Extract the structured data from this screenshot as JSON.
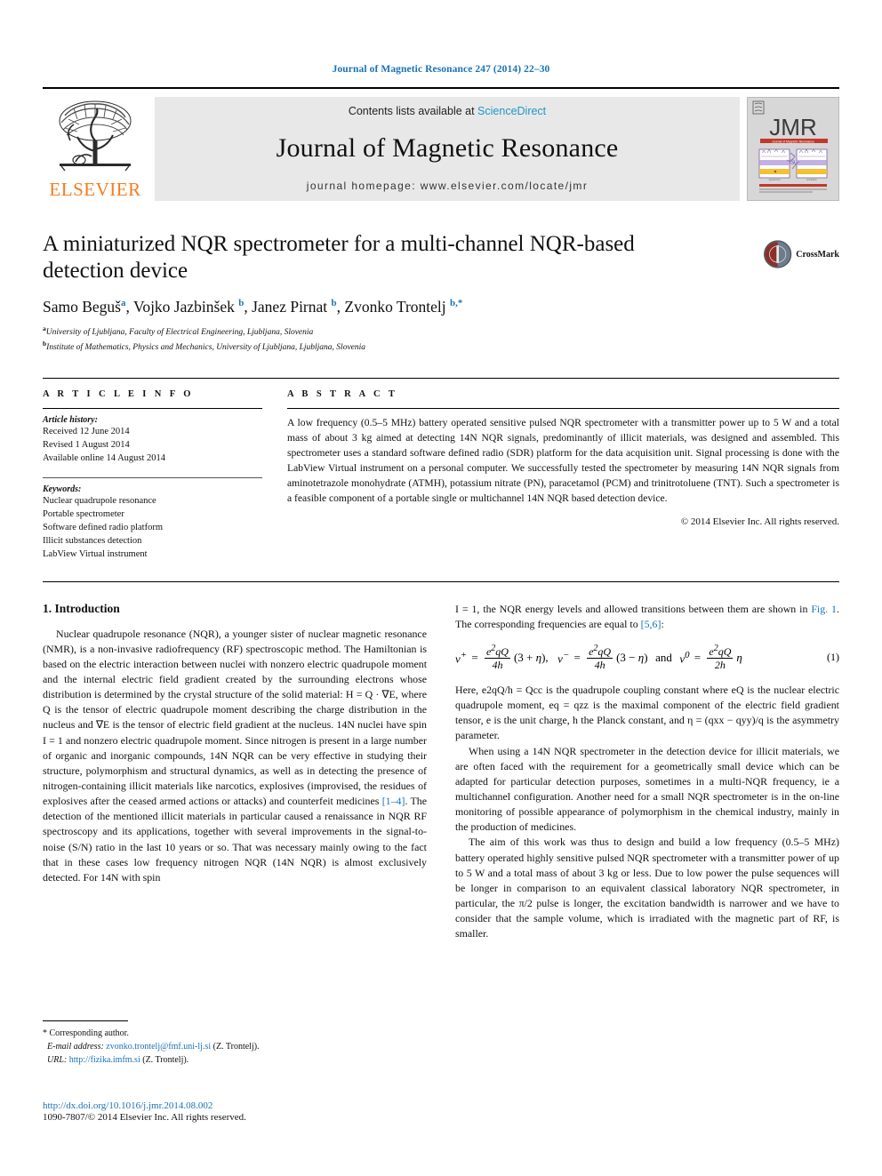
{
  "running_head": "Journal of Magnetic Resonance 247 (2014) 22–30",
  "masthead": {
    "contents_prefix": "Contents lists available at ",
    "sciencedirect": "ScienceDirect",
    "journal_title": "Journal of Magnetic Resonance",
    "homepage": "journal homepage: www.elsevier.com/locate/jmr",
    "publisher_wordmark": "ELSEVIER",
    "cover_title": "JMR",
    "cover_subtitle": "Journal of Magnetic Resonance",
    "cover_footer": "ScienceDirect",
    "accent_orange": "#F47C20",
    "accent_blue": "#1a72b8",
    "cover_red": "#c0392b"
  },
  "article": {
    "title": "A miniaturized NQR spectrometer for a multi-channel NQR-based detection device",
    "authors": [
      {
        "name": "Samo Beguš",
        "sup": "a"
      },
      {
        "name": "Vojko Jazbinšek",
        "sup": "b"
      },
      {
        "name": "Janez Pirnat",
        "sup": "b"
      },
      {
        "name": "Zvonko Trontelj",
        "sup": "b,*"
      }
    ],
    "affiliations": [
      {
        "mark": "a",
        "text": "University of Ljubljana, Faculty of Electrical Engineering, Ljubljana, Slovenia"
      },
      {
        "mark": "b",
        "text": "Institute of Mathematics, Physics and Mechanics, University of Ljubljana, Ljubljana, Slovenia"
      }
    ],
    "crossmark_label": "CrossMark"
  },
  "article_info": {
    "heading": "A R T I C L E   I N F O",
    "history_label": "Article history:",
    "history": [
      "Received 12 June 2014",
      "Revised 1 August 2014",
      "Available online 14 August 2014"
    ],
    "keywords_label": "Keywords:",
    "keywords": [
      "Nuclear quadrupole resonance",
      "Portable spectrometer",
      "Software defined radio platform",
      "Illicit substances detection",
      "LabView Virtual instrument"
    ]
  },
  "abstract": {
    "heading": "A B S T R A C T",
    "text": "A low frequency (0.5–5 MHz) battery operated sensitive pulsed NQR spectrometer with a transmitter power up to 5 W and a total mass of about 3 kg aimed at detecting 14N NQR signals, predominantly of illicit materials, was designed and assembled. This spectrometer uses a standard software defined radio (SDR) platform for the data acquisition unit. Signal processing is done with the LabView Virtual instrument on a personal computer. We successfully tested the spectrometer by measuring 14N NQR signals from aminotetrazole monohydrate (ATMH), potassium nitrate (PN), paracetamol (PCM) and trinitrotoluene (TNT). Such a spectrometer is a feasible component of a portable single or multichannel 14N NQR based detection device.",
    "copyright": "© 2014 Elsevier Inc. All rights reserved."
  },
  "body": {
    "section_number_title": "1. Introduction",
    "left_paragraph_1": "Nuclear quadrupole resonance (NQR), a younger sister of nuclear magnetic resonance (NMR), is a non-invasive radiofrequency (RF) spectroscopic method. The Hamiltonian is based on the electric interaction between nuclei with nonzero electric quadrupole moment and the internal electric field gradient created by the surrounding electrons whose distribution is determined by the crystal structure of the solid material: H = Q · ∇E, where Q is the tensor of electric quadrupole moment describing the charge distribution in the nucleus and ∇E is the tensor of electric field gradient at the nucleus. 14N nuclei have spin I = 1 and nonzero electric quadrupole moment. Since nitrogen is present in a large number of organic and inorganic compounds, 14N NQR can be very effective in studying their structure, polymorphism and structural dynamics, as well as in detecting the presence of nitrogen-containing illicit materials like narcotics, explosives (improvised, the residues of explosives after the ceased armed actions or attacks) and counterfeit medicines ",
    "cite_1_4": "[1–4]",
    "left_paragraph_1_cont": ". The detection of the mentioned illicit materials in particular caused a renaissance in NQR RF spectroscopy and its applications, together with several improvements in the signal-to-noise (S/N) ratio in the last 10 years or so. That was necessary mainly owing to the fact that in these cases low frequency nitrogen NQR (14N NQR) is almost exclusively detected. For 14N with spin",
    "right_paragraph_1a": "I = 1, the NQR energy levels and allowed transitions between them are shown in ",
    "fig_link": "Fig. 1",
    "right_paragraph_1b": ". The corresponding frequencies are equal to ",
    "cite_5_6": "[5,6]",
    "right_paragraph_1c": ":",
    "equation": {
      "number": "(1)",
      "terms": [
        {
          "lhs": "ν+",
          "num": "e2qQ",
          "den": "4h",
          "rhs": "(3 + η),"
        },
        {
          "lhs": "ν−",
          "num": "e2qQ",
          "den": "4h",
          "rhs": "(3 − η)"
        },
        {
          "connector": "and"
        },
        {
          "lhs": "ν0",
          "num": "e2qQ",
          "den": "2h",
          "rhs": "η"
        }
      ]
    },
    "right_paragraph_2": "Here, e2qQ/h = Qcc is the quadrupole coupling constant where eQ is the nuclear electric quadrupole moment, eq = qzz is the maximal component of the electric field gradient tensor, e is the unit charge, h the Planck constant, and η = (qxx − qyy)/q is the asymmetry parameter.",
    "right_paragraph_3": "When using a 14N NQR spectrometer in the detection device for illicit materials, we are often faced with the requirement for a geometrically small device which can be adapted for particular detection purposes, sometimes in a multi-NQR frequency, ie a multichannel configuration. Another need for a small NQR spectrometer is in the on-line monitoring of possible appearance of polymorphism in the chemical industry, mainly in the production of medicines.",
    "right_paragraph_4": "The aim of this work was thus to design and build a low frequency (0.5–5 MHz) battery operated highly sensitive pulsed NQR spectrometer with a transmitter power of up to 5 W and a total mass of about 3 kg or less. Due to low power the pulse sequences will be longer in comparison to an equivalent classical laboratory NQR spectrometer, in particular, the π/2 pulse is longer, the excitation bandwidth is narrower and we have to consider that the sample volume, which is irradiated with the magnetic part of RF, is smaller."
  },
  "footnotes": {
    "corresponding": "Corresponding author.",
    "email_label": "E-mail address:",
    "email": "zvonko.trontelj@fmf.uni-lj.si",
    "email_owner": "(Z. Trontelj).",
    "url_label": "URL:",
    "url": "http://fizika.imfm.si",
    "url_owner": "(Z. Trontelj)."
  },
  "footer": {
    "doi": "http://dx.doi.org/10.1016/j.jmr.2014.08.002",
    "issn_line": "1090-7807/© 2014 Elsevier Inc. All rights reserved."
  }
}
